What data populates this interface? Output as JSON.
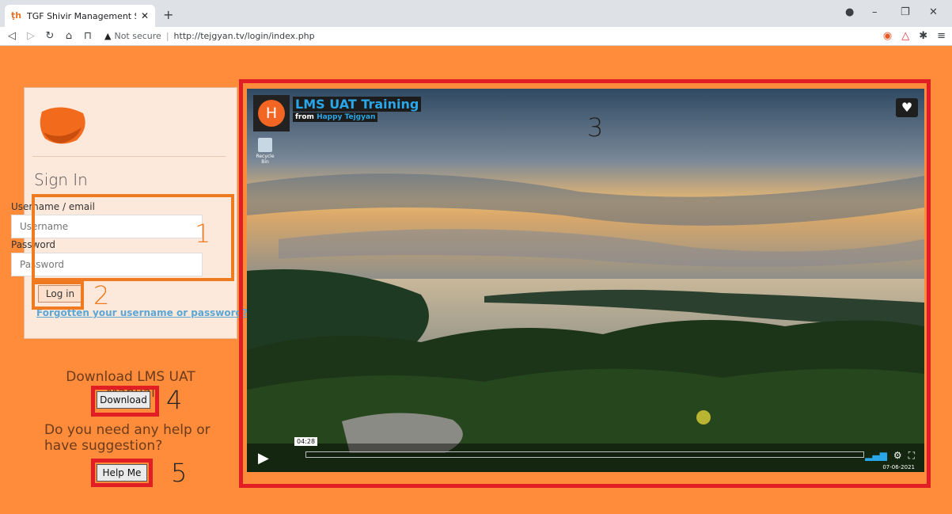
{
  "browser": {
    "tab_title": "TGF Shivir Management System:  ",
    "tab_icon": "happy-thoughts-favicon",
    "security_label": "Not secure",
    "url": "http://tejgyan.tv/login/index.php"
  },
  "login": {
    "heading": "Sign In",
    "username_label": "Username / email",
    "username_placeholder": "Username",
    "password_label": "Password",
    "password_placeholder": "Password",
    "login_button": "Log in",
    "forgot_link": "Forgotten your username or password?"
  },
  "downloads": {
    "manual_text": "Download LMS UAT Manual",
    "download_button": "Download",
    "help_text": "Do you need any help or have suggestion?",
    "help_button": "Help Me"
  },
  "annotations": [
    "1",
    "2",
    "3",
    "4",
    "5"
  ],
  "video": {
    "title": "LMS UAT Training",
    "from_prefix": "from",
    "channel": "Happy Tejgyan",
    "avatar_letter": "H",
    "recycle_label": "Recycle Bin",
    "current_time": "04:28",
    "date": "07-06-2021"
  },
  "colors": {
    "page_bg": "#ff8c3b",
    "annotation_orange": "#f07a1f",
    "annotation_red": "#e01e24",
    "link_blue": "#5aa7d6",
    "video_blue": "#2aa7e8"
  }
}
